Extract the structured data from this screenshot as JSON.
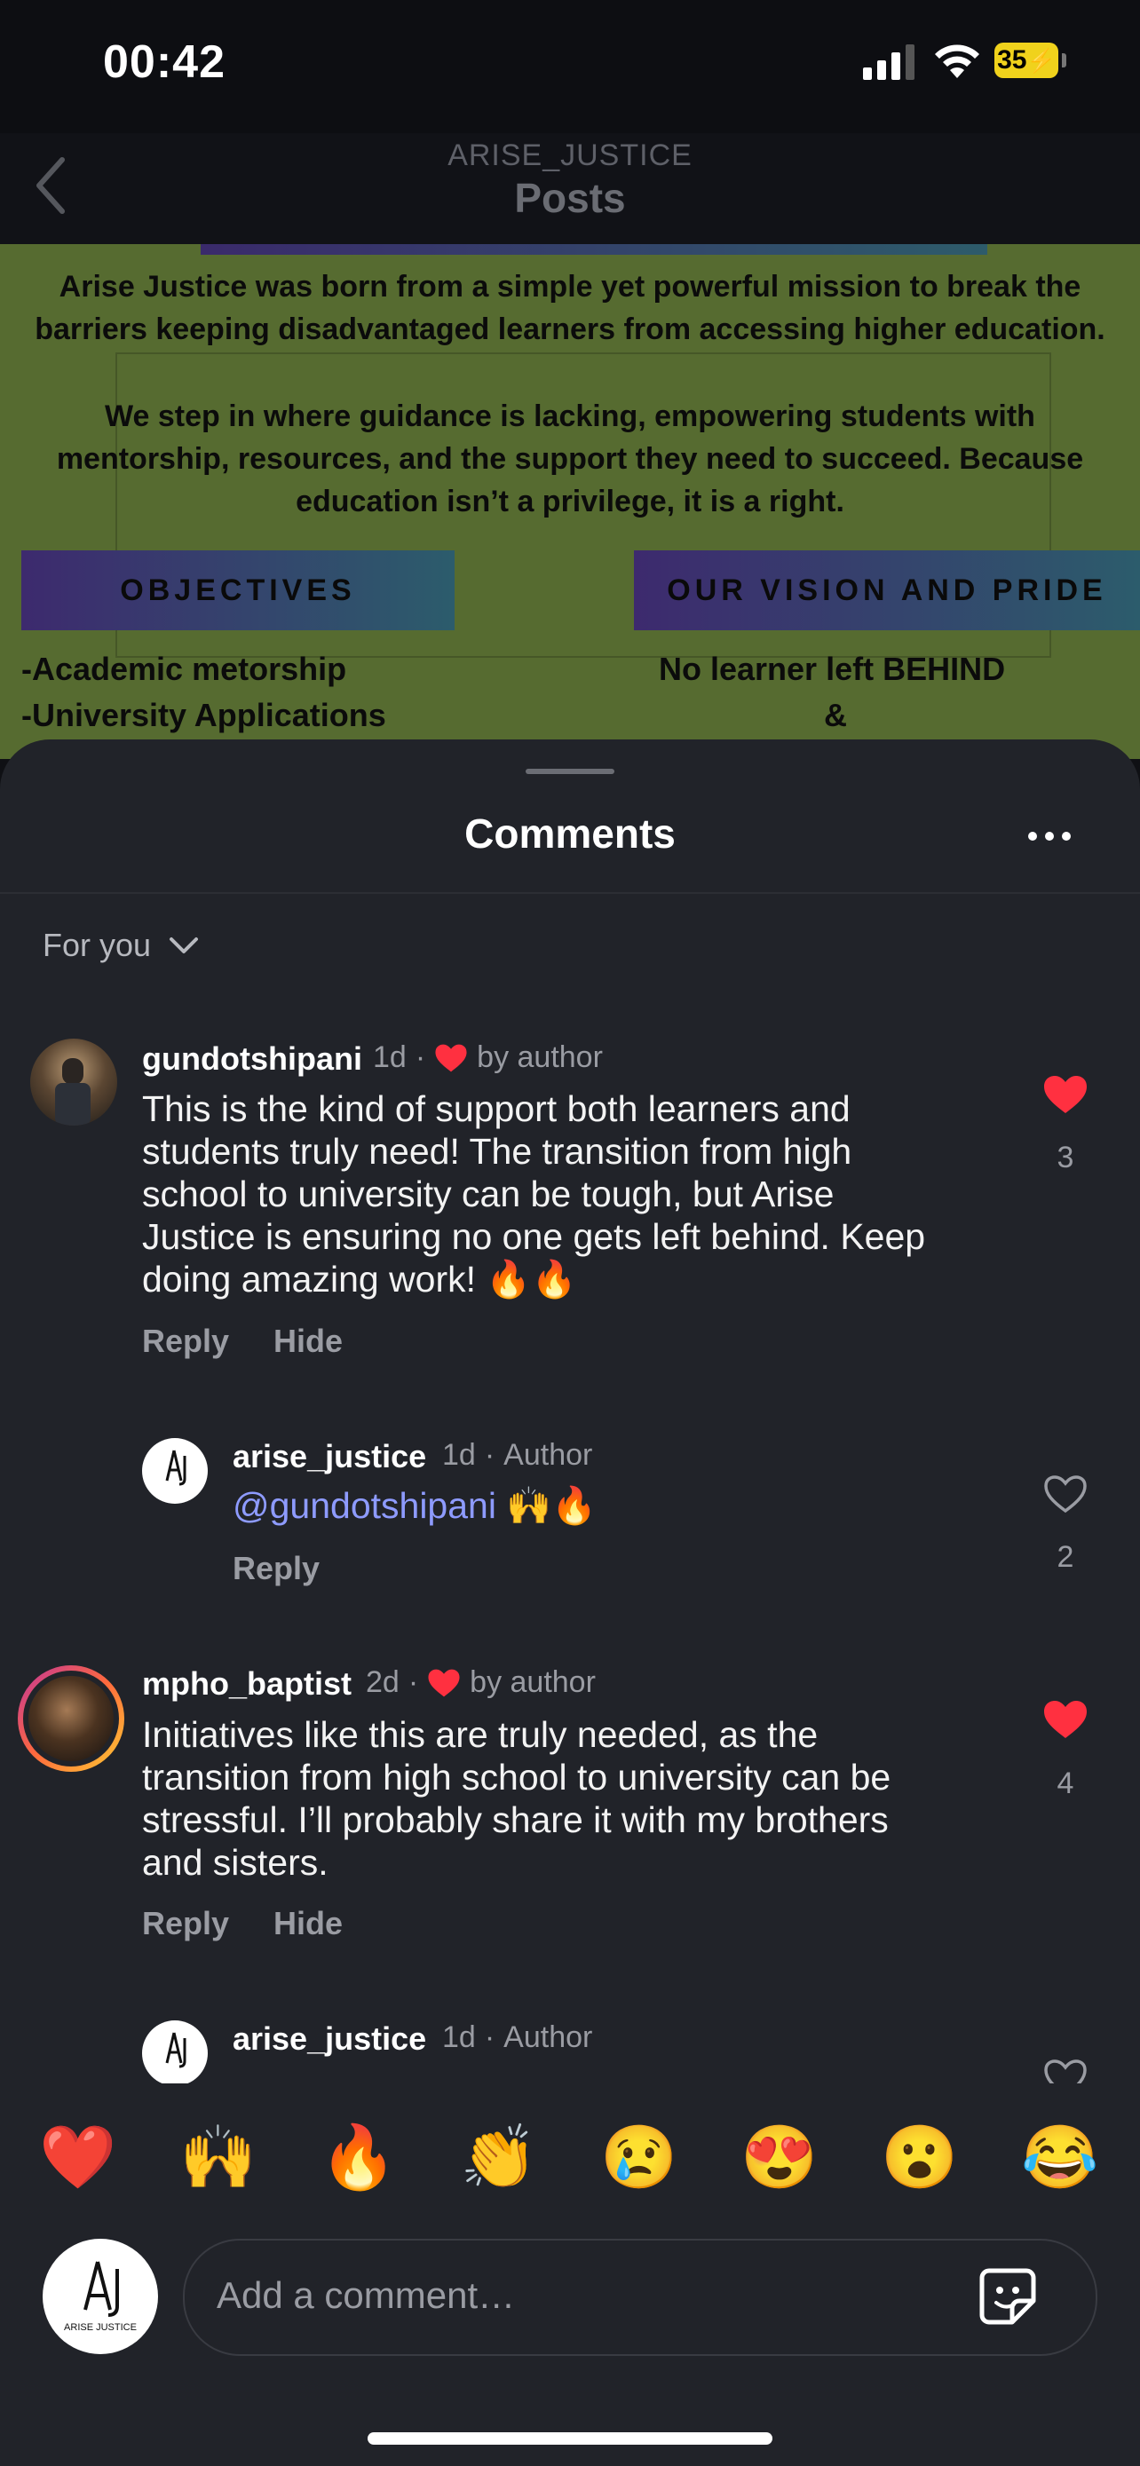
{
  "status_bar": {
    "time": "00:42",
    "battery": "35"
  },
  "header": {
    "account": "ARISE_JUSTICE",
    "title": "Posts"
  },
  "post": {
    "intro": [
      "Arise Justice was born from a simple yet powerful mission to break the",
      "barriers keeping disadvantaged learners from accessing higher education."
    ],
    "body": [
      "We step in where guidance is lacking, empowering students with",
      "mentorship, resources, and the support they need to succeed. Because",
      "education isn’t a privilege, it is a right."
    ],
    "objectives_label": "OBJECTIVES",
    "vision_label": "OUR VISION AND PRIDE",
    "objectives": [
      "-Academic metorship",
      "-University Applications"
    ],
    "vision": [
      "No learner left BEHIND",
      "&"
    ]
  },
  "sheet": {
    "title": "Comments",
    "filter": "For you"
  },
  "comments": [
    {
      "username": "gundotshipani",
      "age": "1d",
      "badge": "by author",
      "text": [
        "This is the kind of support both learners and",
        "students truly need! The transition from high",
        "school to university can be tough, but Arise",
        "Justice is ensuring no one gets left behind. Keep",
        "doing amazing work! 🔥🔥"
      ],
      "reply": "Reply",
      "hide": "Hide",
      "likes": "3",
      "liked": true
    },
    {
      "username": "arise_justice",
      "age": "1d",
      "badge": "Author",
      "mention": "@gundotshipani",
      "emojis": "🙌🔥",
      "reply": "Reply",
      "likes": "2",
      "liked": false
    },
    {
      "username": "mpho_baptist",
      "age": "2d",
      "badge": "by author",
      "text": [
        "Initiatives like this are truly needed, as the",
        "transition from high school to university can be",
        "stressful. I’ll probably share it with my brothers",
        "and sisters."
      ],
      "reply": "Reply",
      "hide": "Hide",
      "likes": "4",
      "liked": true
    },
    {
      "username": "arise_justice",
      "age": "1d",
      "badge": "Author"
    }
  ],
  "reactions": [
    "❤️",
    "🙌",
    "🔥",
    "👏",
    "😢",
    "😍",
    "😮",
    "😂"
  ],
  "input": {
    "placeholder": "Add a comment…",
    "avatar_text": "ARISE JUSTICE"
  },
  "colors": {
    "like_red": "#ff3040",
    "mention": "#8e9bff",
    "post_bg": "#566b30"
  }
}
